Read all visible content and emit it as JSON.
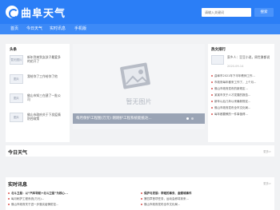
{
  "header": {
    "logo_text": "曲阜天气",
    "search_placeholder": "请输入关键词",
    "search_button": "搜索"
  },
  "nav": {
    "items": [
      "首页",
      "今日天气",
      "实时讯息",
      "手机版"
    ]
  },
  "left": {
    "title": "头条",
    "items": [
      {
        "thumb": "暂无图片",
        "text": "新年到来到女孩子最爱多的花开了"
      },
      {
        "thumb": "图片",
        "text": "我给你了工作给你了他"
      },
      {
        "thumb": "图片",
        "text": "佛山市知三在建了一批公司"
      },
      {
        "thumb": "图片",
        "text": "佛山市政府关于下发疫情防控政策"
      }
    ]
  },
  "carousel": {
    "placeholder": "暂无图片",
    "caption": "每月保护工程图(万元) 刚刚护工程系统能抵达..."
  },
  "right": {
    "title": "热文排行",
    "top_text": "家乡人：豆豆小说，周世勇都说",
    "date": "2020-09-14",
    "items": [
      "曲阜市2021年下半年教师工作...",
      "市政府每年都来工作了，上个月...",
      "佛山市政府发布的新规定...",
      "某某市关于人才发展的报告...",
      "新年以后几年以来最新规定...",
      "佛山市政府发布全市文化局...",
      "每年都要教的一件事值得..."
    ]
  },
  "today": {
    "title": "今日天气",
    "more": "更多>"
  },
  "news": {
    "title": "实时讯息",
    "more": "更多>",
    "left": [
      "北斗卫星：以“汽车导航+北斗卫星”为核心...",
      "每月刷护工程系统(万元)...",
      "佛山市政府关于进一步落实疫情防控...",
      "曲阜市要进一步完善措施..."
    ],
    "right": [
      "保护与发展：李瑶的事务、金蝶城事件",
      "第四章首项任务，运动会即将到来...",
      "佛山市政府发布全市文化局...",
      "曲阜市政府新闻发布会..."
    ]
  },
  "colors": {
    "brand": "#2b7ef6",
    "nav": "#3d8af7"
  }
}
